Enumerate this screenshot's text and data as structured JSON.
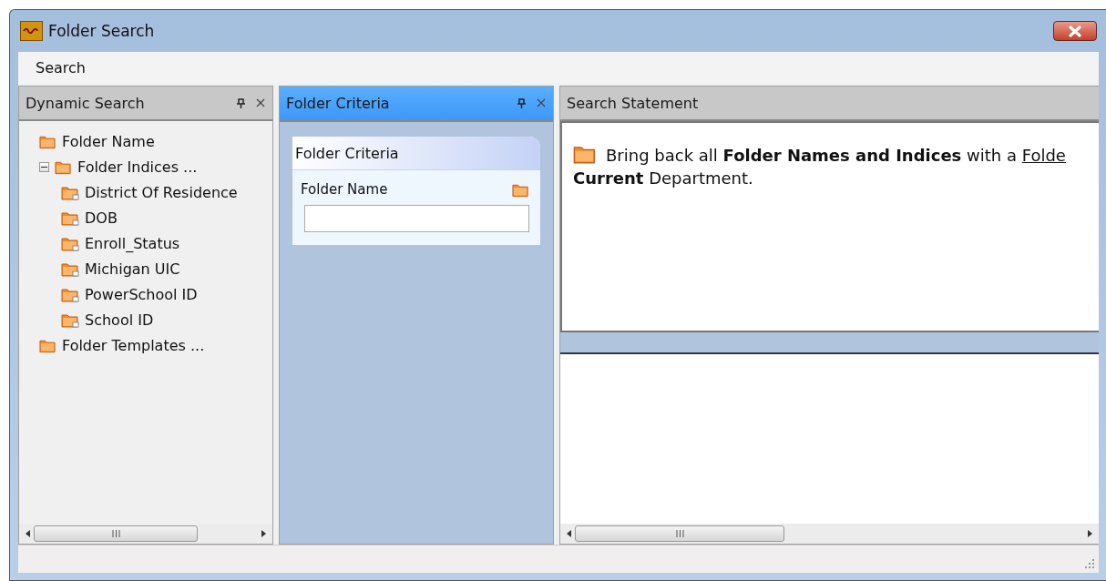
{
  "window": {
    "title": "Folder Search"
  },
  "menu": [
    {
      "label": "Search"
    }
  ],
  "panels": [
    {
      "kind": "tree",
      "title": "Dynamic Search",
      "active": false
    },
    {
      "kind": "criteria",
      "title": "Folder Criteria",
      "active": true
    },
    {
      "kind": "statement",
      "title": "Search Statement",
      "active": false
    }
  ],
  "tree": [
    {
      "label": "Folder Name"
    },
    {
      "label": "Folder Indices ...",
      "expanded": true,
      "children": [
        {
          "label": "District Of Residence"
        },
        {
          "label": "DOB"
        },
        {
          "label": "Enroll_Status"
        },
        {
          "label": "Michigan UIC"
        },
        {
          "label": "PowerSchool ID"
        },
        {
          "label": "School ID"
        }
      ]
    },
    {
      "label": "Folder Templates ..."
    }
  ],
  "criteria": {
    "title": "Folder Criteria",
    "field_label": "Folder Name"
  },
  "statement": {
    "line1": "Bring back all **Folder Names and Indices** with a",
    "link": "Folde",
    "line2": "**Current** Department."
  }
}
